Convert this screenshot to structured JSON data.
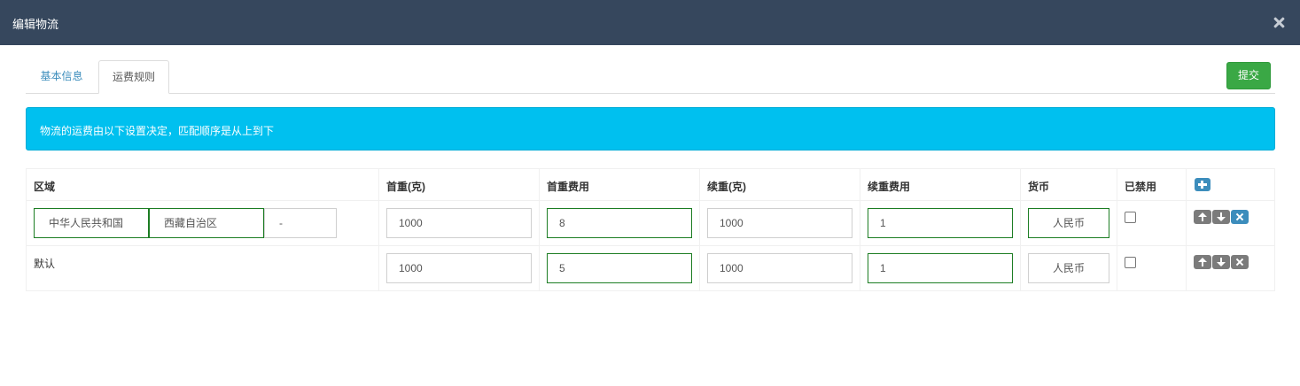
{
  "header": {
    "title": "编辑物流"
  },
  "tabs": [
    {
      "label": "基本信息",
      "active": false
    },
    {
      "label": "运费规则",
      "active": true
    }
  ],
  "actions": {
    "submit_label": "提交"
  },
  "alert": {
    "text": "物流的运费由以下设置决定，匹配顺序是从上到下"
  },
  "table": {
    "headers": [
      "区域",
      "首重(克)",
      "首重费用",
      "续重(克)",
      "续重费用",
      "货币",
      "已禁用"
    ],
    "rows": [
      {
        "region": {
          "country": "中华人民共和国",
          "province": "西藏自治区",
          "city": "-"
        },
        "first_weight": "1000",
        "first_fee": "8",
        "extra_weight": "1000",
        "extra_fee": "1",
        "currency": "人民币",
        "disabled": false
      },
      {
        "region_label": "默认",
        "first_weight": "1000",
        "first_fee": "5",
        "extra_weight": "1000",
        "extra_fee": "1",
        "currency": "人民币",
        "disabled": false
      }
    ]
  },
  "colors": {
    "header_bg": "#36475d",
    "alert_bg": "#00c0ef",
    "submit_bg": "#3aa845",
    "active_input_border": "#1c7d23",
    "primary_button": "#3c8dbc"
  }
}
